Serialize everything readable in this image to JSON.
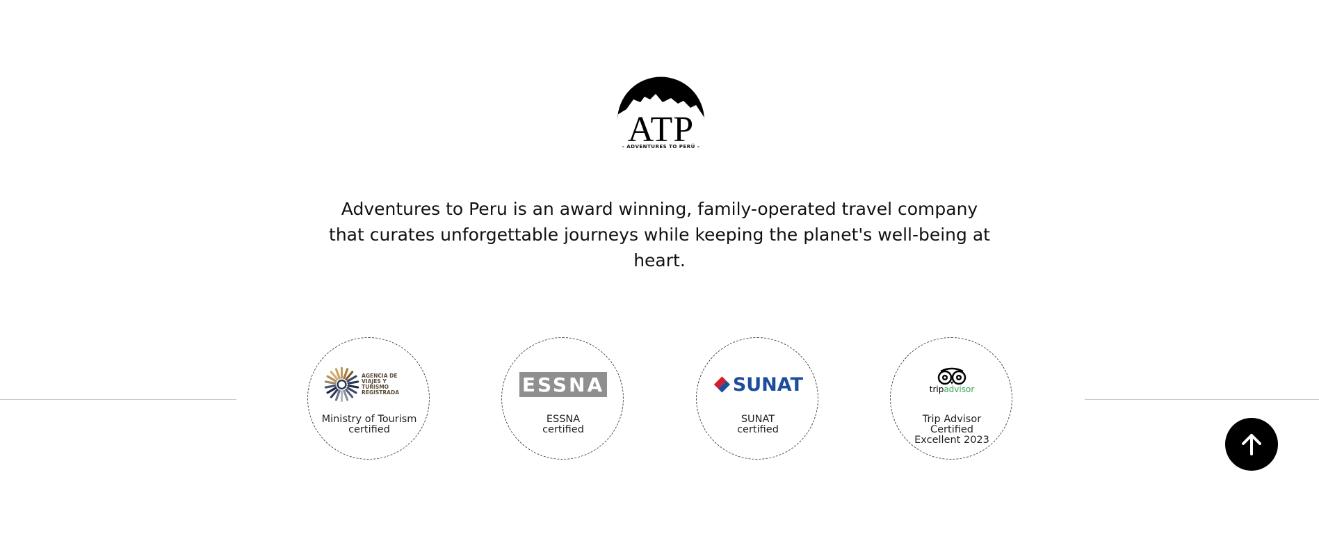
{
  "logo": {
    "wordmark": "ATP",
    "tagline": "- ADVENTURES TO PERÚ -"
  },
  "intro": {
    "lines": [
      "Adventures to Peru is an award winning, family-operated travel company",
      "that curates unforgettable journeys while keeping the planet's well-being at",
      "heart."
    ]
  },
  "certifications": [
    {
      "logo_lines": [
        "AGENCIA DE",
        "VIAJES Y TURISMO",
        "REGISTRADA"
      ],
      "caption_lines": [
        "Ministry of Tourism",
        "certified"
      ]
    },
    {
      "logo_text": "ESSNA",
      "caption_lines": [
        "ESSNA",
        "certified"
      ]
    },
    {
      "logo_text": "SUNAT",
      "caption_lines": [
        "SUNAT",
        "certified"
      ]
    },
    {
      "logo_text": [
        "trip",
        "advisor"
      ],
      "caption_lines": [
        "Trip Advisor",
        "Certified",
        "Excellent 2023"
      ]
    }
  ],
  "back_to_top": {
    "icon": "arrow-up-icon"
  },
  "colors": {
    "essna_gray": "#8f8f8f",
    "sunat_blue": "#1d4e9c",
    "sunat_red": "#d0202e",
    "tripadvisor_green": "#34a853",
    "button_bg": "#000000"
  }
}
